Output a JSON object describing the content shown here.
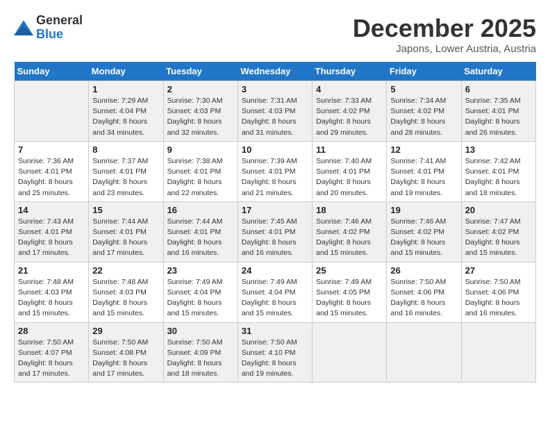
{
  "header": {
    "logo_general": "General",
    "logo_blue": "Blue",
    "month": "December 2025",
    "location": "Japons, Lower Austria, Austria"
  },
  "weekdays": [
    "Sunday",
    "Monday",
    "Tuesday",
    "Wednesday",
    "Thursday",
    "Friday",
    "Saturday"
  ],
  "weeks": [
    [
      {
        "day": "",
        "sunrise": "",
        "sunset": "",
        "daylight": ""
      },
      {
        "day": "1",
        "sunrise": "Sunrise: 7:29 AM",
        "sunset": "Sunset: 4:04 PM",
        "daylight": "Daylight: 8 hours and 34 minutes."
      },
      {
        "day": "2",
        "sunrise": "Sunrise: 7:30 AM",
        "sunset": "Sunset: 4:03 PM",
        "daylight": "Daylight: 8 hours and 32 minutes."
      },
      {
        "day": "3",
        "sunrise": "Sunrise: 7:31 AM",
        "sunset": "Sunset: 4:03 PM",
        "daylight": "Daylight: 8 hours and 31 minutes."
      },
      {
        "day": "4",
        "sunrise": "Sunrise: 7:33 AM",
        "sunset": "Sunset: 4:02 PM",
        "daylight": "Daylight: 8 hours and 29 minutes."
      },
      {
        "day": "5",
        "sunrise": "Sunrise: 7:34 AM",
        "sunset": "Sunset: 4:02 PM",
        "daylight": "Daylight: 8 hours and 28 minutes."
      },
      {
        "day": "6",
        "sunrise": "Sunrise: 7:35 AM",
        "sunset": "Sunset: 4:01 PM",
        "daylight": "Daylight: 8 hours and 26 minutes."
      }
    ],
    [
      {
        "day": "7",
        "sunrise": "Sunrise: 7:36 AM",
        "sunset": "Sunset: 4:01 PM",
        "daylight": "Daylight: 8 hours and 25 minutes."
      },
      {
        "day": "8",
        "sunrise": "Sunrise: 7:37 AM",
        "sunset": "Sunset: 4:01 PM",
        "daylight": "Daylight: 8 hours and 23 minutes."
      },
      {
        "day": "9",
        "sunrise": "Sunrise: 7:38 AM",
        "sunset": "Sunset: 4:01 PM",
        "daylight": "Daylight: 8 hours and 22 minutes."
      },
      {
        "day": "10",
        "sunrise": "Sunrise: 7:39 AM",
        "sunset": "Sunset: 4:01 PM",
        "daylight": "Daylight: 8 hours and 21 minutes."
      },
      {
        "day": "11",
        "sunrise": "Sunrise: 7:40 AM",
        "sunset": "Sunset: 4:01 PM",
        "daylight": "Daylight: 8 hours and 20 minutes."
      },
      {
        "day": "12",
        "sunrise": "Sunrise: 7:41 AM",
        "sunset": "Sunset: 4:01 PM",
        "daylight": "Daylight: 8 hours and 19 minutes."
      },
      {
        "day": "13",
        "sunrise": "Sunrise: 7:42 AM",
        "sunset": "Sunset: 4:01 PM",
        "daylight": "Daylight: 8 hours and 18 minutes."
      }
    ],
    [
      {
        "day": "14",
        "sunrise": "Sunrise: 7:43 AM",
        "sunset": "Sunset: 4:01 PM",
        "daylight": "Daylight: 8 hours and 17 minutes."
      },
      {
        "day": "15",
        "sunrise": "Sunrise: 7:44 AM",
        "sunset": "Sunset: 4:01 PM",
        "daylight": "Daylight: 8 hours and 17 minutes."
      },
      {
        "day": "16",
        "sunrise": "Sunrise: 7:44 AM",
        "sunset": "Sunset: 4:01 PM",
        "daylight": "Daylight: 8 hours and 16 minutes."
      },
      {
        "day": "17",
        "sunrise": "Sunrise: 7:45 AM",
        "sunset": "Sunset: 4:01 PM",
        "daylight": "Daylight: 8 hours and 16 minutes."
      },
      {
        "day": "18",
        "sunrise": "Sunrise: 7:46 AM",
        "sunset": "Sunset: 4:02 PM",
        "daylight": "Daylight: 8 hours and 15 minutes."
      },
      {
        "day": "19",
        "sunrise": "Sunrise: 7:46 AM",
        "sunset": "Sunset: 4:02 PM",
        "daylight": "Daylight: 8 hours and 15 minutes."
      },
      {
        "day": "20",
        "sunrise": "Sunrise: 7:47 AM",
        "sunset": "Sunset: 4:02 PM",
        "daylight": "Daylight: 8 hours and 15 minutes."
      }
    ],
    [
      {
        "day": "21",
        "sunrise": "Sunrise: 7:48 AM",
        "sunset": "Sunset: 4:03 PM",
        "daylight": "Daylight: 8 hours and 15 minutes."
      },
      {
        "day": "22",
        "sunrise": "Sunrise: 7:48 AM",
        "sunset": "Sunset: 4:03 PM",
        "daylight": "Daylight: 8 hours and 15 minutes."
      },
      {
        "day": "23",
        "sunrise": "Sunrise: 7:49 AM",
        "sunset": "Sunset: 4:04 PM",
        "daylight": "Daylight: 8 hours and 15 minutes."
      },
      {
        "day": "24",
        "sunrise": "Sunrise: 7:49 AM",
        "sunset": "Sunset: 4:04 PM",
        "daylight": "Daylight: 8 hours and 15 minutes."
      },
      {
        "day": "25",
        "sunrise": "Sunrise: 7:49 AM",
        "sunset": "Sunset: 4:05 PM",
        "daylight": "Daylight: 8 hours and 15 minutes."
      },
      {
        "day": "26",
        "sunrise": "Sunrise: 7:50 AM",
        "sunset": "Sunset: 4:06 PM",
        "daylight": "Daylight: 8 hours and 16 minutes."
      },
      {
        "day": "27",
        "sunrise": "Sunrise: 7:50 AM",
        "sunset": "Sunset: 4:06 PM",
        "daylight": "Daylight: 8 hours and 16 minutes."
      }
    ],
    [
      {
        "day": "28",
        "sunrise": "Sunrise: 7:50 AM",
        "sunset": "Sunset: 4:07 PM",
        "daylight": "Daylight: 8 hours and 17 minutes."
      },
      {
        "day": "29",
        "sunrise": "Sunrise: 7:50 AM",
        "sunset": "Sunset: 4:08 PM",
        "daylight": "Daylight: 8 hours and 17 minutes."
      },
      {
        "day": "30",
        "sunrise": "Sunrise: 7:50 AM",
        "sunset": "Sunset: 4:09 PM",
        "daylight": "Daylight: 8 hours and 18 minutes."
      },
      {
        "day": "31",
        "sunrise": "Sunrise: 7:50 AM",
        "sunset": "Sunset: 4:10 PM",
        "daylight": "Daylight: 8 hours and 19 minutes."
      },
      {
        "day": "",
        "sunrise": "",
        "sunset": "",
        "daylight": ""
      },
      {
        "day": "",
        "sunrise": "",
        "sunset": "",
        "daylight": ""
      },
      {
        "day": "",
        "sunrise": "",
        "sunset": "",
        "daylight": ""
      }
    ]
  ]
}
